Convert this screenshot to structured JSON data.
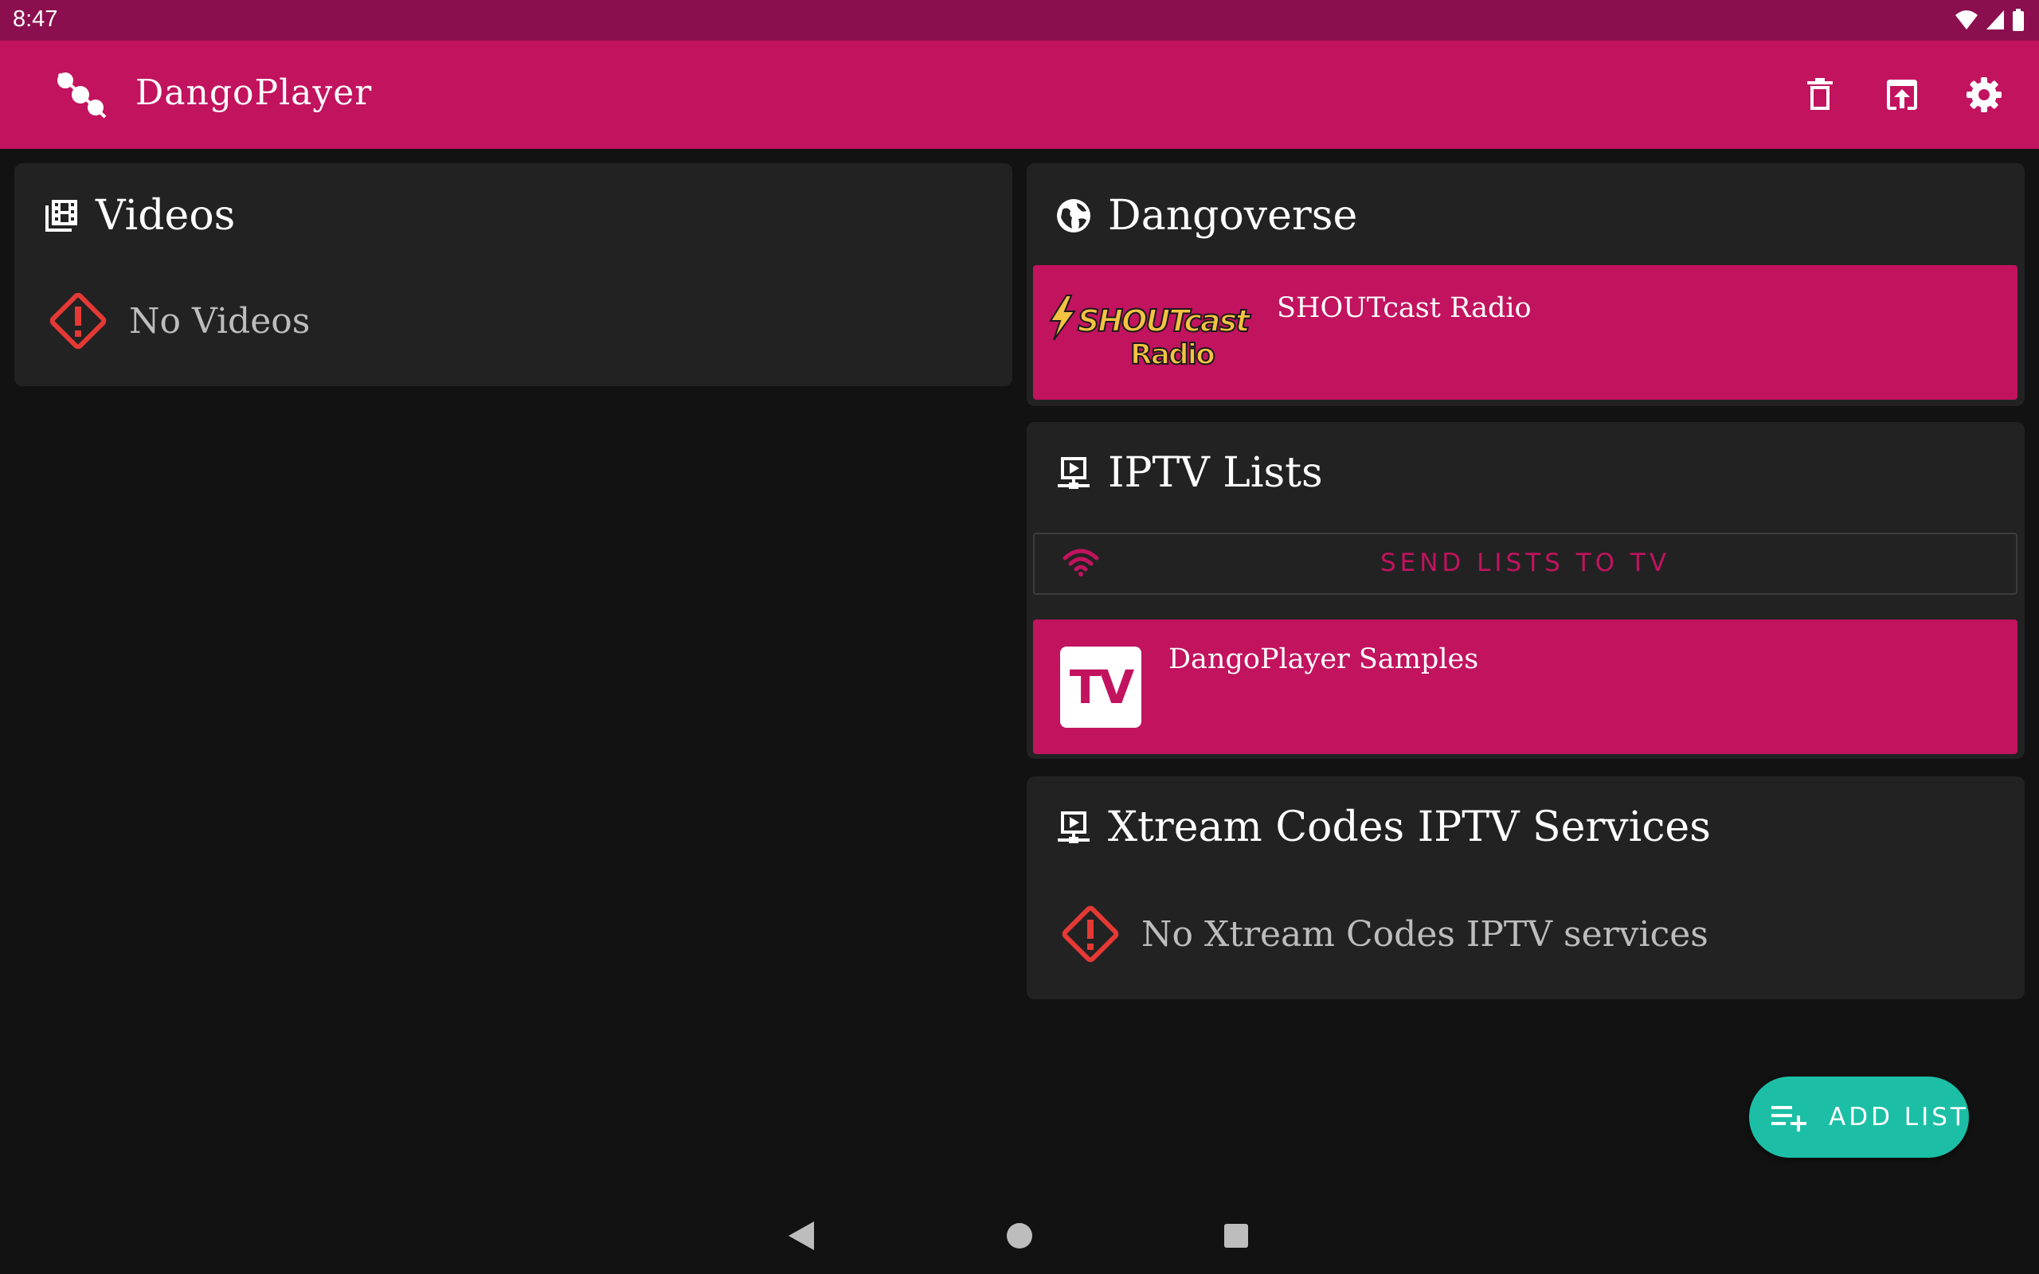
{
  "status_bar": {
    "time": "8:47",
    "icons": [
      "wifi-icon",
      "signal-icon",
      "battery-icon"
    ]
  },
  "app_bar": {
    "title": "DangoPlayer",
    "logo_icon": "dango-logo-icon",
    "actions": [
      {
        "name": "delete-button",
        "icon": "trash-icon"
      },
      {
        "name": "open-external-button",
        "icon": "open-in-new-icon"
      },
      {
        "name": "settings-button",
        "icon": "gear-icon"
      }
    ]
  },
  "videos": {
    "title": "Videos",
    "icon": "video-library-icon",
    "empty_text": "No Videos"
  },
  "dangoverse": {
    "title": "Dangoverse",
    "icon": "globe-icon",
    "items": [
      {
        "label": "SHOUTcast Radio",
        "logo_line1": "SHOUTcast",
        "logo_line2": "Radio"
      }
    ]
  },
  "iptv": {
    "title": "IPTV Lists",
    "icon": "tv-playlist-icon",
    "send_label": "SEND LISTS TO TV",
    "items": [
      {
        "label": "DangoPlayer Samples",
        "logo": "TV"
      }
    ]
  },
  "xtream": {
    "title": "Xtream Codes IPTV Services",
    "icon": "tv-playlist-icon",
    "empty_text": "No Xtream Codes IPTV services"
  },
  "fab": {
    "label": "ADD LIST",
    "icon": "playlist-add-icon"
  },
  "colors": {
    "status_bar": "#8b0f4f",
    "primary": "#c2135f",
    "background": "#121212",
    "card": "#222222",
    "fab": "#1cbfa6",
    "warning": "#e53935"
  }
}
